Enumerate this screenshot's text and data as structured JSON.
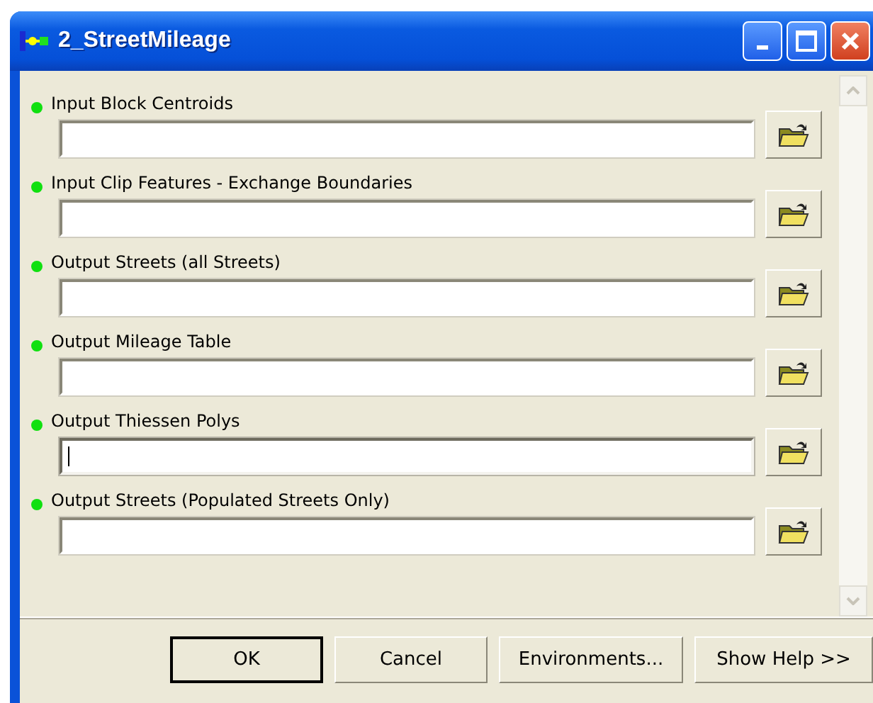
{
  "window": {
    "title": "2_StreetMileage"
  },
  "parameters": [
    {
      "label": "Input Block Centroids",
      "focused": false
    },
    {
      "label": "Input Clip Features - Exchange Boundaries",
      "focused": false
    },
    {
      "label": "Output Streets (all Streets)",
      "focused": false
    },
    {
      "label": "Output Mileage Table",
      "focused": false
    },
    {
      "label": "Output Thiessen Polys",
      "focused": true
    },
    {
      "label": "Output Streets (Populated Streets Only)",
      "focused": false
    }
  ],
  "buttons": [
    {
      "label": "OK",
      "default": true
    },
    {
      "label": "Cancel",
      "default": false
    },
    {
      "label": "Environments...",
      "default": false
    },
    {
      "label": "Show Help >>",
      "default": false
    }
  ]
}
